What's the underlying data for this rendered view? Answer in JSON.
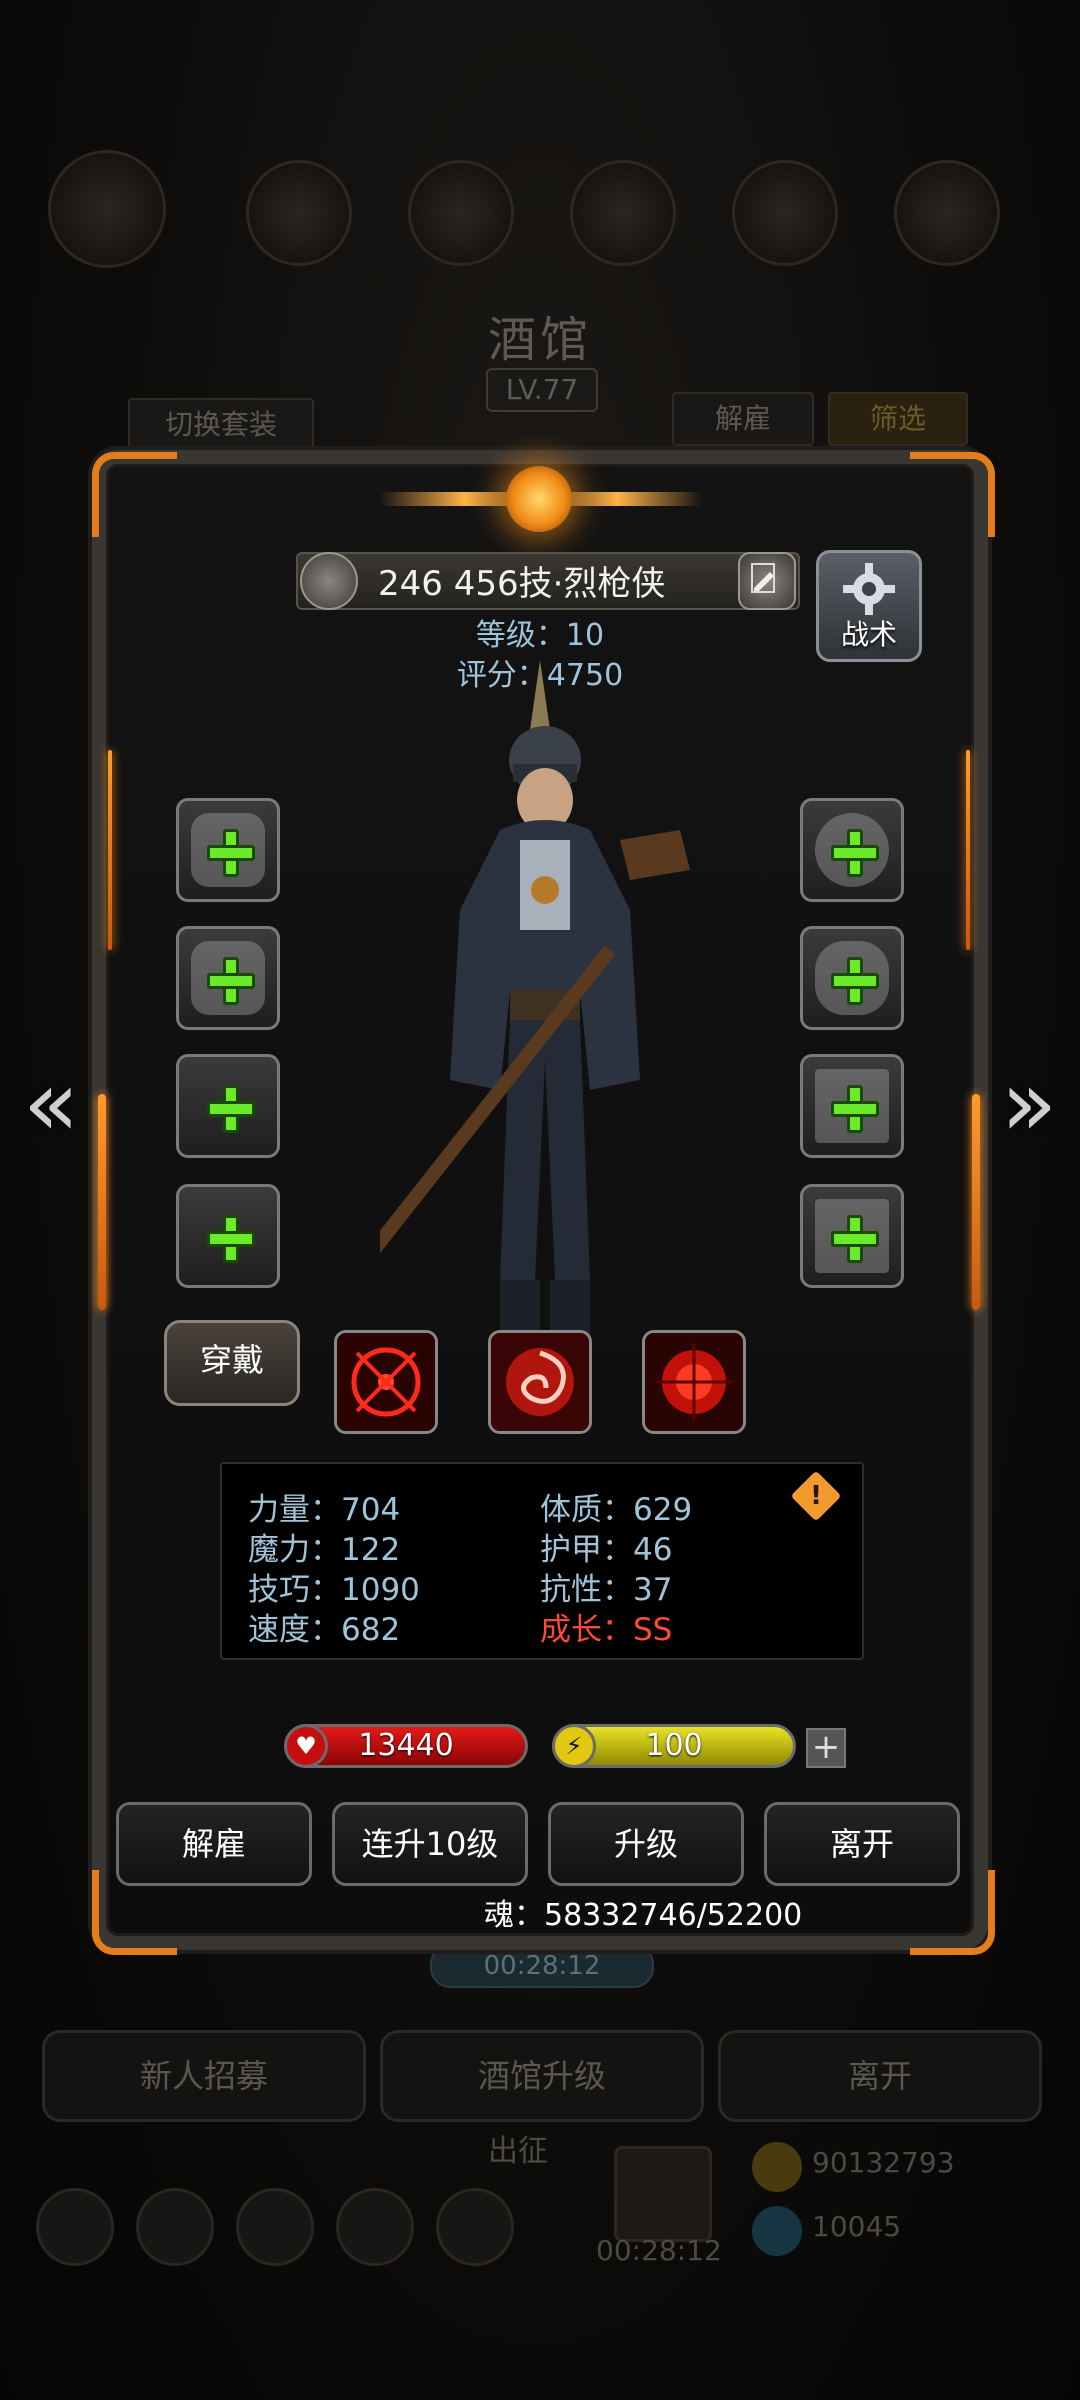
{
  "background": {
    "title": "酒馆",
    "level": "LV.77",
    "switch_outfit": "切换套装",
    "dismiss": "解雇",
    "filter": "筛选",
    "timer": "00:28:12",
    "bottom_buttons": [
      "新人招募",
      "酒馆升级",
      "离开"
    ],
    "expedition": "出征",
    "expedition_timer": "00:28:12",
    "gold": "90132793",
    "gems": "10045"
  },
  "hero": {
    "id": "246",
    "name": "456技·烈枪侠",
    "level_label": "等级：10",
    "score_label": "评分：4750",
    "tactic_label": "战术",
    "wear_label": "穿戴"
  },
  "stats": [
    {
      "label": "力量：704"
    },
    {
      "label": "魔力：122"
    },
    {
      "label": "技巧：1090"
    },
    {
      "label": "速度：682"
    },
    {
      "label": "体质：629"
    },
    {
      "label": "护甲：46"
    },
    {
      "label": "抗性：37"
    },
    {
      "label": "成长：SS",
      "color": "#ff4a35"
    }
  ],
  "bars": {
    "hp": "13440",
    "energy": "100"
  },
  "actions": [
    "解雇",
    "连升10级",
    "升级",
    "离开"
  ],
  "soul": "魂：58332746/52200",
  "icons": {
    "left_slots": [
      "weapon-slot-icon",
      "armor-slot-icon",
      "ring-slot-icon",
      "ring-slot-icon"
    ],
    "right_slots": [
      "helmet-slot-icon",
      "glove-slot-icon",
      "accessory-slot-icon",
      "accessory-slot-icon"
    ],
    "skills": [
      "crosshair-skill-icon",
      "swirl-skill-icon",
      "target-skill-icon"
    ]
  },
  "colors": {
    "accent": "#e67d1c",
    "stat": "#9fc3d8",
    "growth": "#ff4a35",
    "plus": "#6bea2c"
  }
}
